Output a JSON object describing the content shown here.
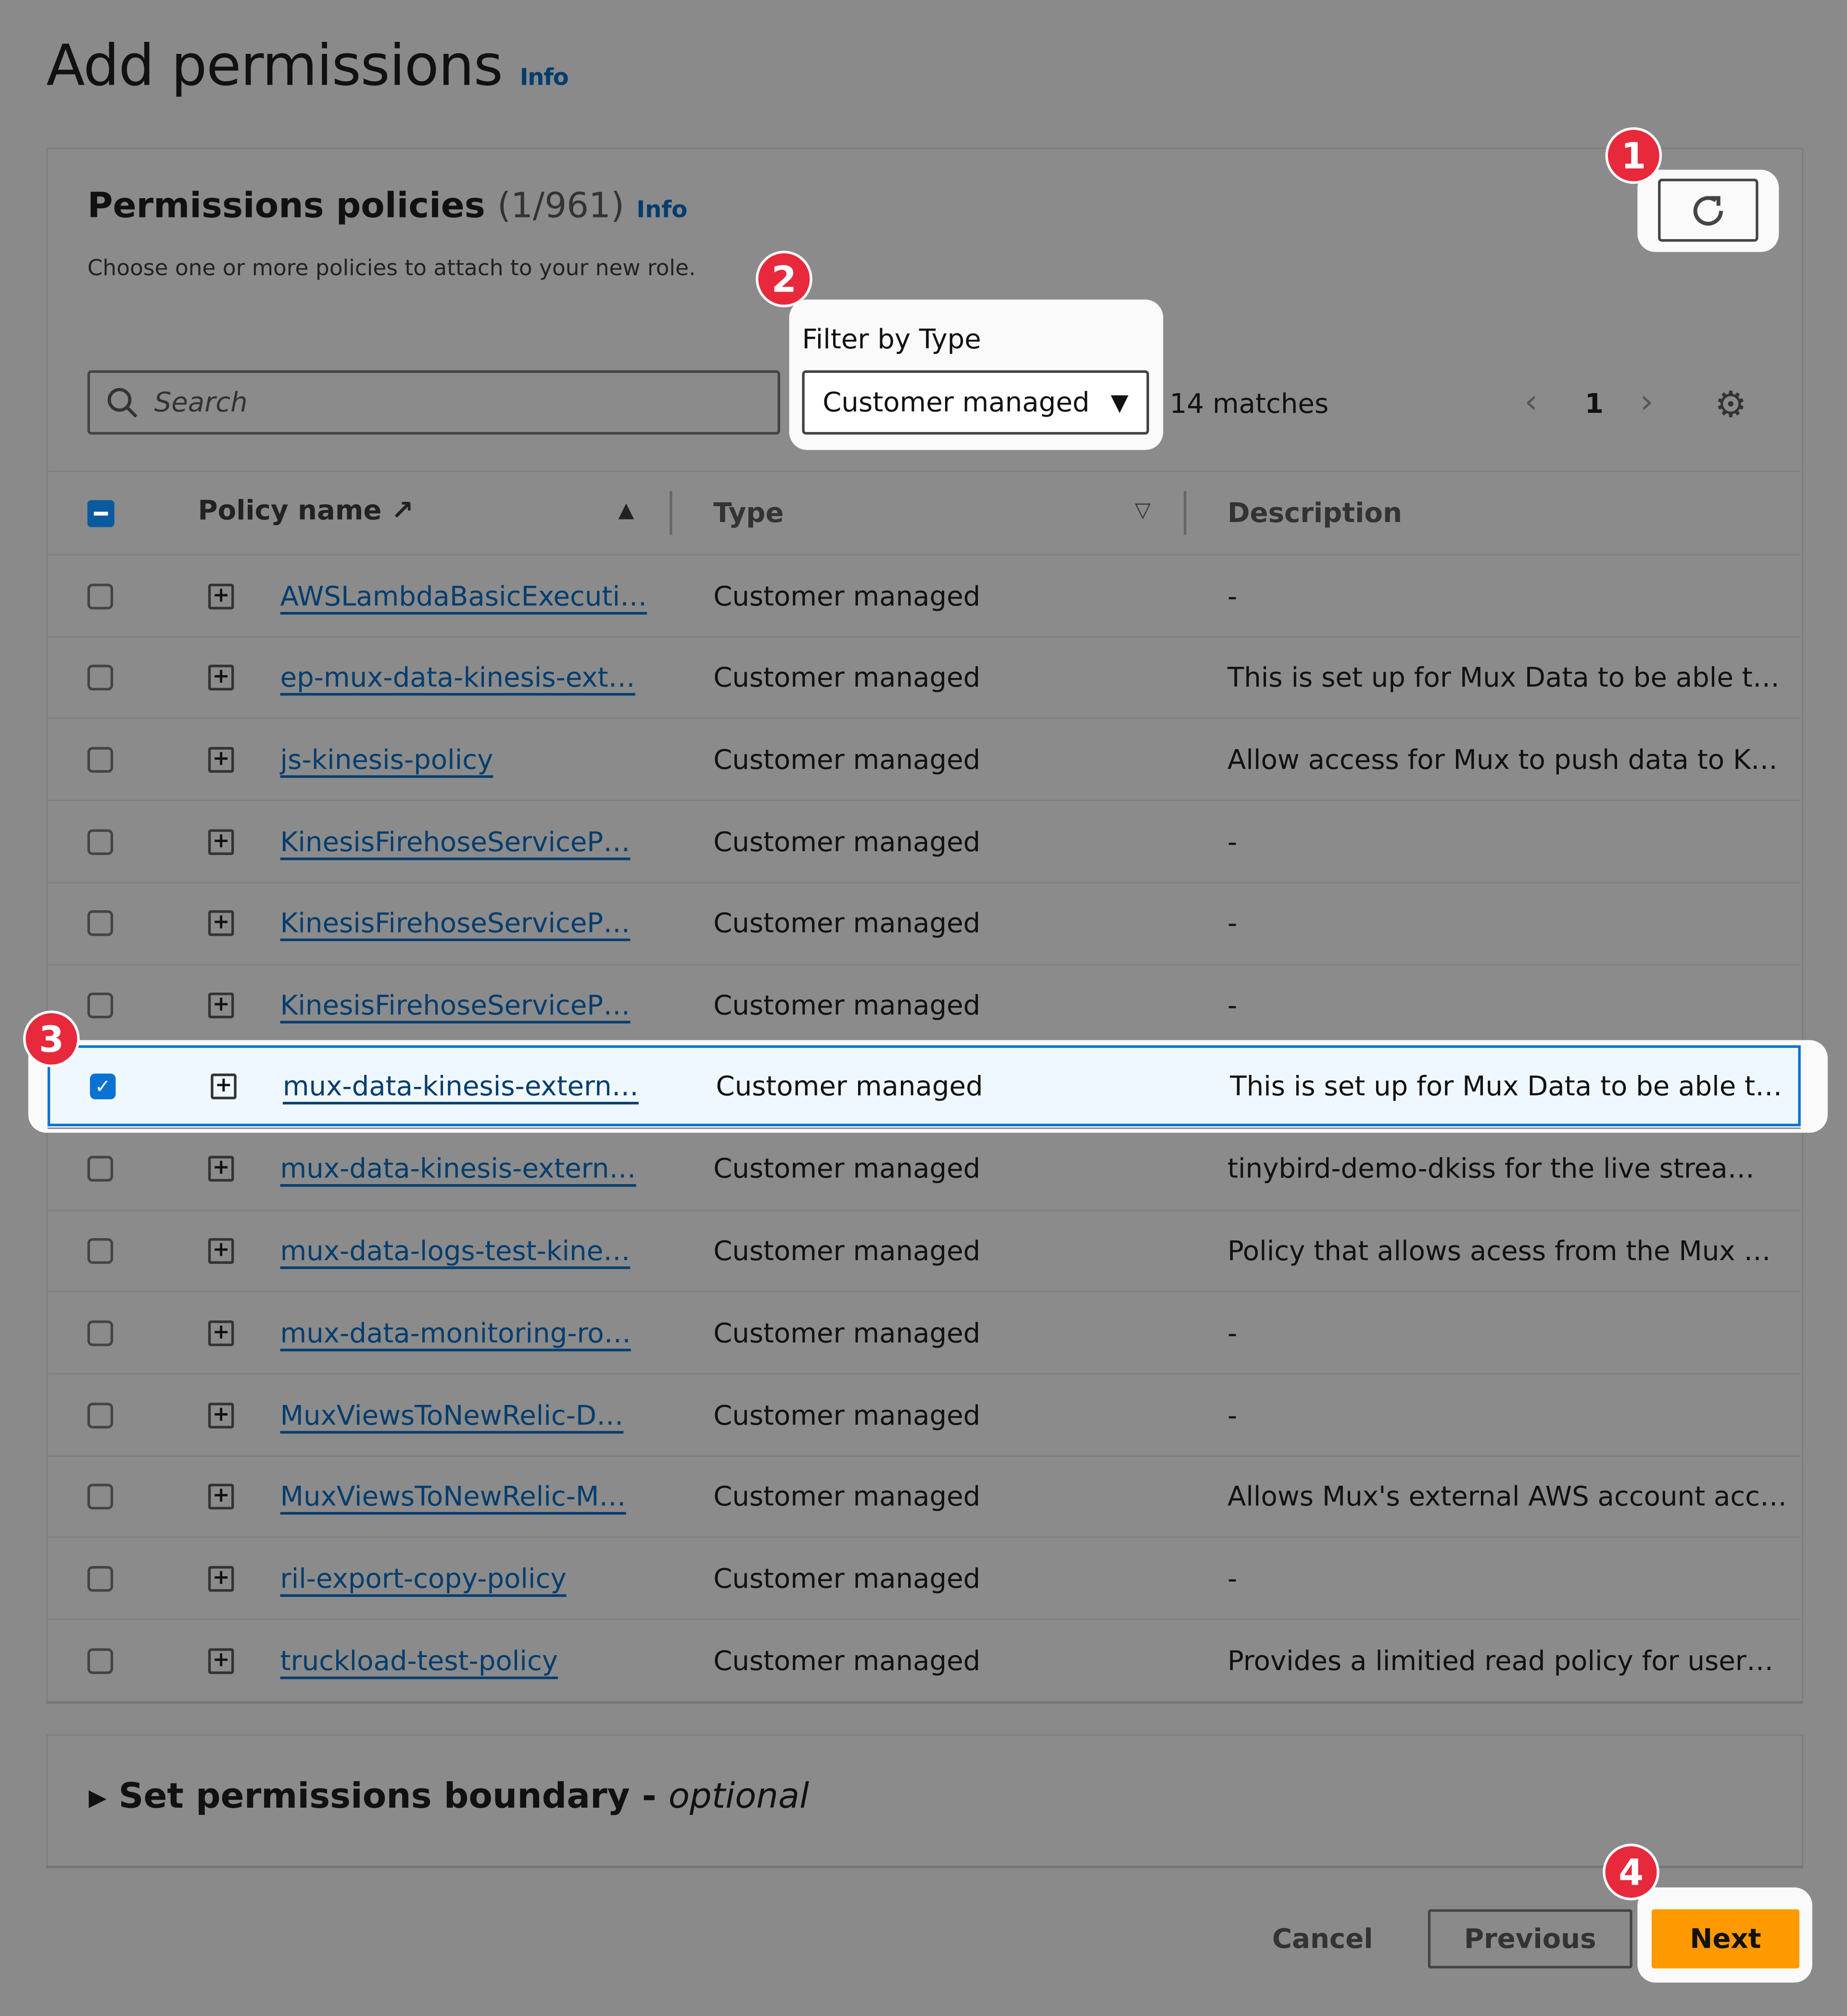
{
  "page": {
    "title": "Add permissions",
    "info": "Info"
  },
  "policies": {
    "title": "Permissions policies",
    "count": "(1/961)",
    "info": "Info",
    "subtitle": "Choose one or more policies to attach to your new role.",
    "search_placeholder": "Search",
    "filter_label": "Filter by Type",
    "filter_value": "Customer managed",
    "matches": "14 matches",
    "page": "1",
    "columns": {
      "name": "Policy name",
      "type": "Type",
      "description": "Description"
    },
    "rows": [
      {
        "name": "AWSLambdaBasicExecuti…",
        "type": "Customer managed",
        "description": "-",
        "checked": false
      },
      {
        "name": "ep-mux-data-kinesis-ext…",
        "type": "Customer managed",
        "description": "This is set up for Mux Data to be able t…",
        "checked": false
      },
      {
        "name": "js-kinesis-policy",
        "type": "Customer managed",
        "description": "Allow access for Mux to push data to K…",
        "checked": false
      },
      {
        "name": "KinesisFirehoseServiceP…",
        "type": "Customer managed",
        "description": "-",
        "checked": false
      },
      {
        "name": "KinesisFirehoseServiceP…",
        "type": "Customer managed",
        "description": "-",
        "checked": false
      },
      {
        "name": "KinesisFirehoseServiceP…",
        "type": "Customer managed",
        "description": "-",
        "checked": false
      },
      {
        "name": "mux-data-kinesis-extern…",
        "type": "Customer managed",
        "description": "This is set up for Mux Data to be able t…",
        "checked": true
      },
      {
        "name": "mux-data-kinesis-extern…",
        "type": "Customer managed",
        "description": "tinybird-demo-dkiss for the live strea…",
        "checked": false
      },
      {
        "name": "mux-data-logs-test-kine…",
        "type": "Customer managed",
        "description": "Policy that allows acess from the Mux …",
        "checked": false
      },
      {
        "name": "mux-data-monitoring-ro…",
        "type": "Customer managed",
        "description": "-",
        "checked": false
      },
      {
        "name": "MuxViewsToNewRelic-D…",
        "type": "Customer managed",
        "description": "-",
        "checked": false
      },
      {
        "name": "MuxViewsToNewRelic-M…",
        "type": "Customer managed",
        "description": "Allows Mux's external AWS account acc…",
        "checked": false
      },
      {
        "name": "ril-export-copy-policy",
        "type": "Customer managed",
        "description": "-",
        "checked": false
      },
      {
        "name": "truckload-test-policy",
        "type": "Customer managed",
        "description": "Provides a limitied read policy for user…",
        "checked": false
      }
    ]
  },
  "boundary": {
    "label": "Set permissions boundary - ",
    "optional": "optional"
  },
  "footer": {
    "cancel": "Cancel",
    "previous": "Previous",
    "next": "Next"
  },
  "badges": [
    "1",
    "2",
    "3",
    "4"
  ],
  "colors": {
    "accent": "#ff9900",
    "link": "#033d6e",
    "checkbox": "#0972d3",
    "badge": "#e8283b"
  }
}
